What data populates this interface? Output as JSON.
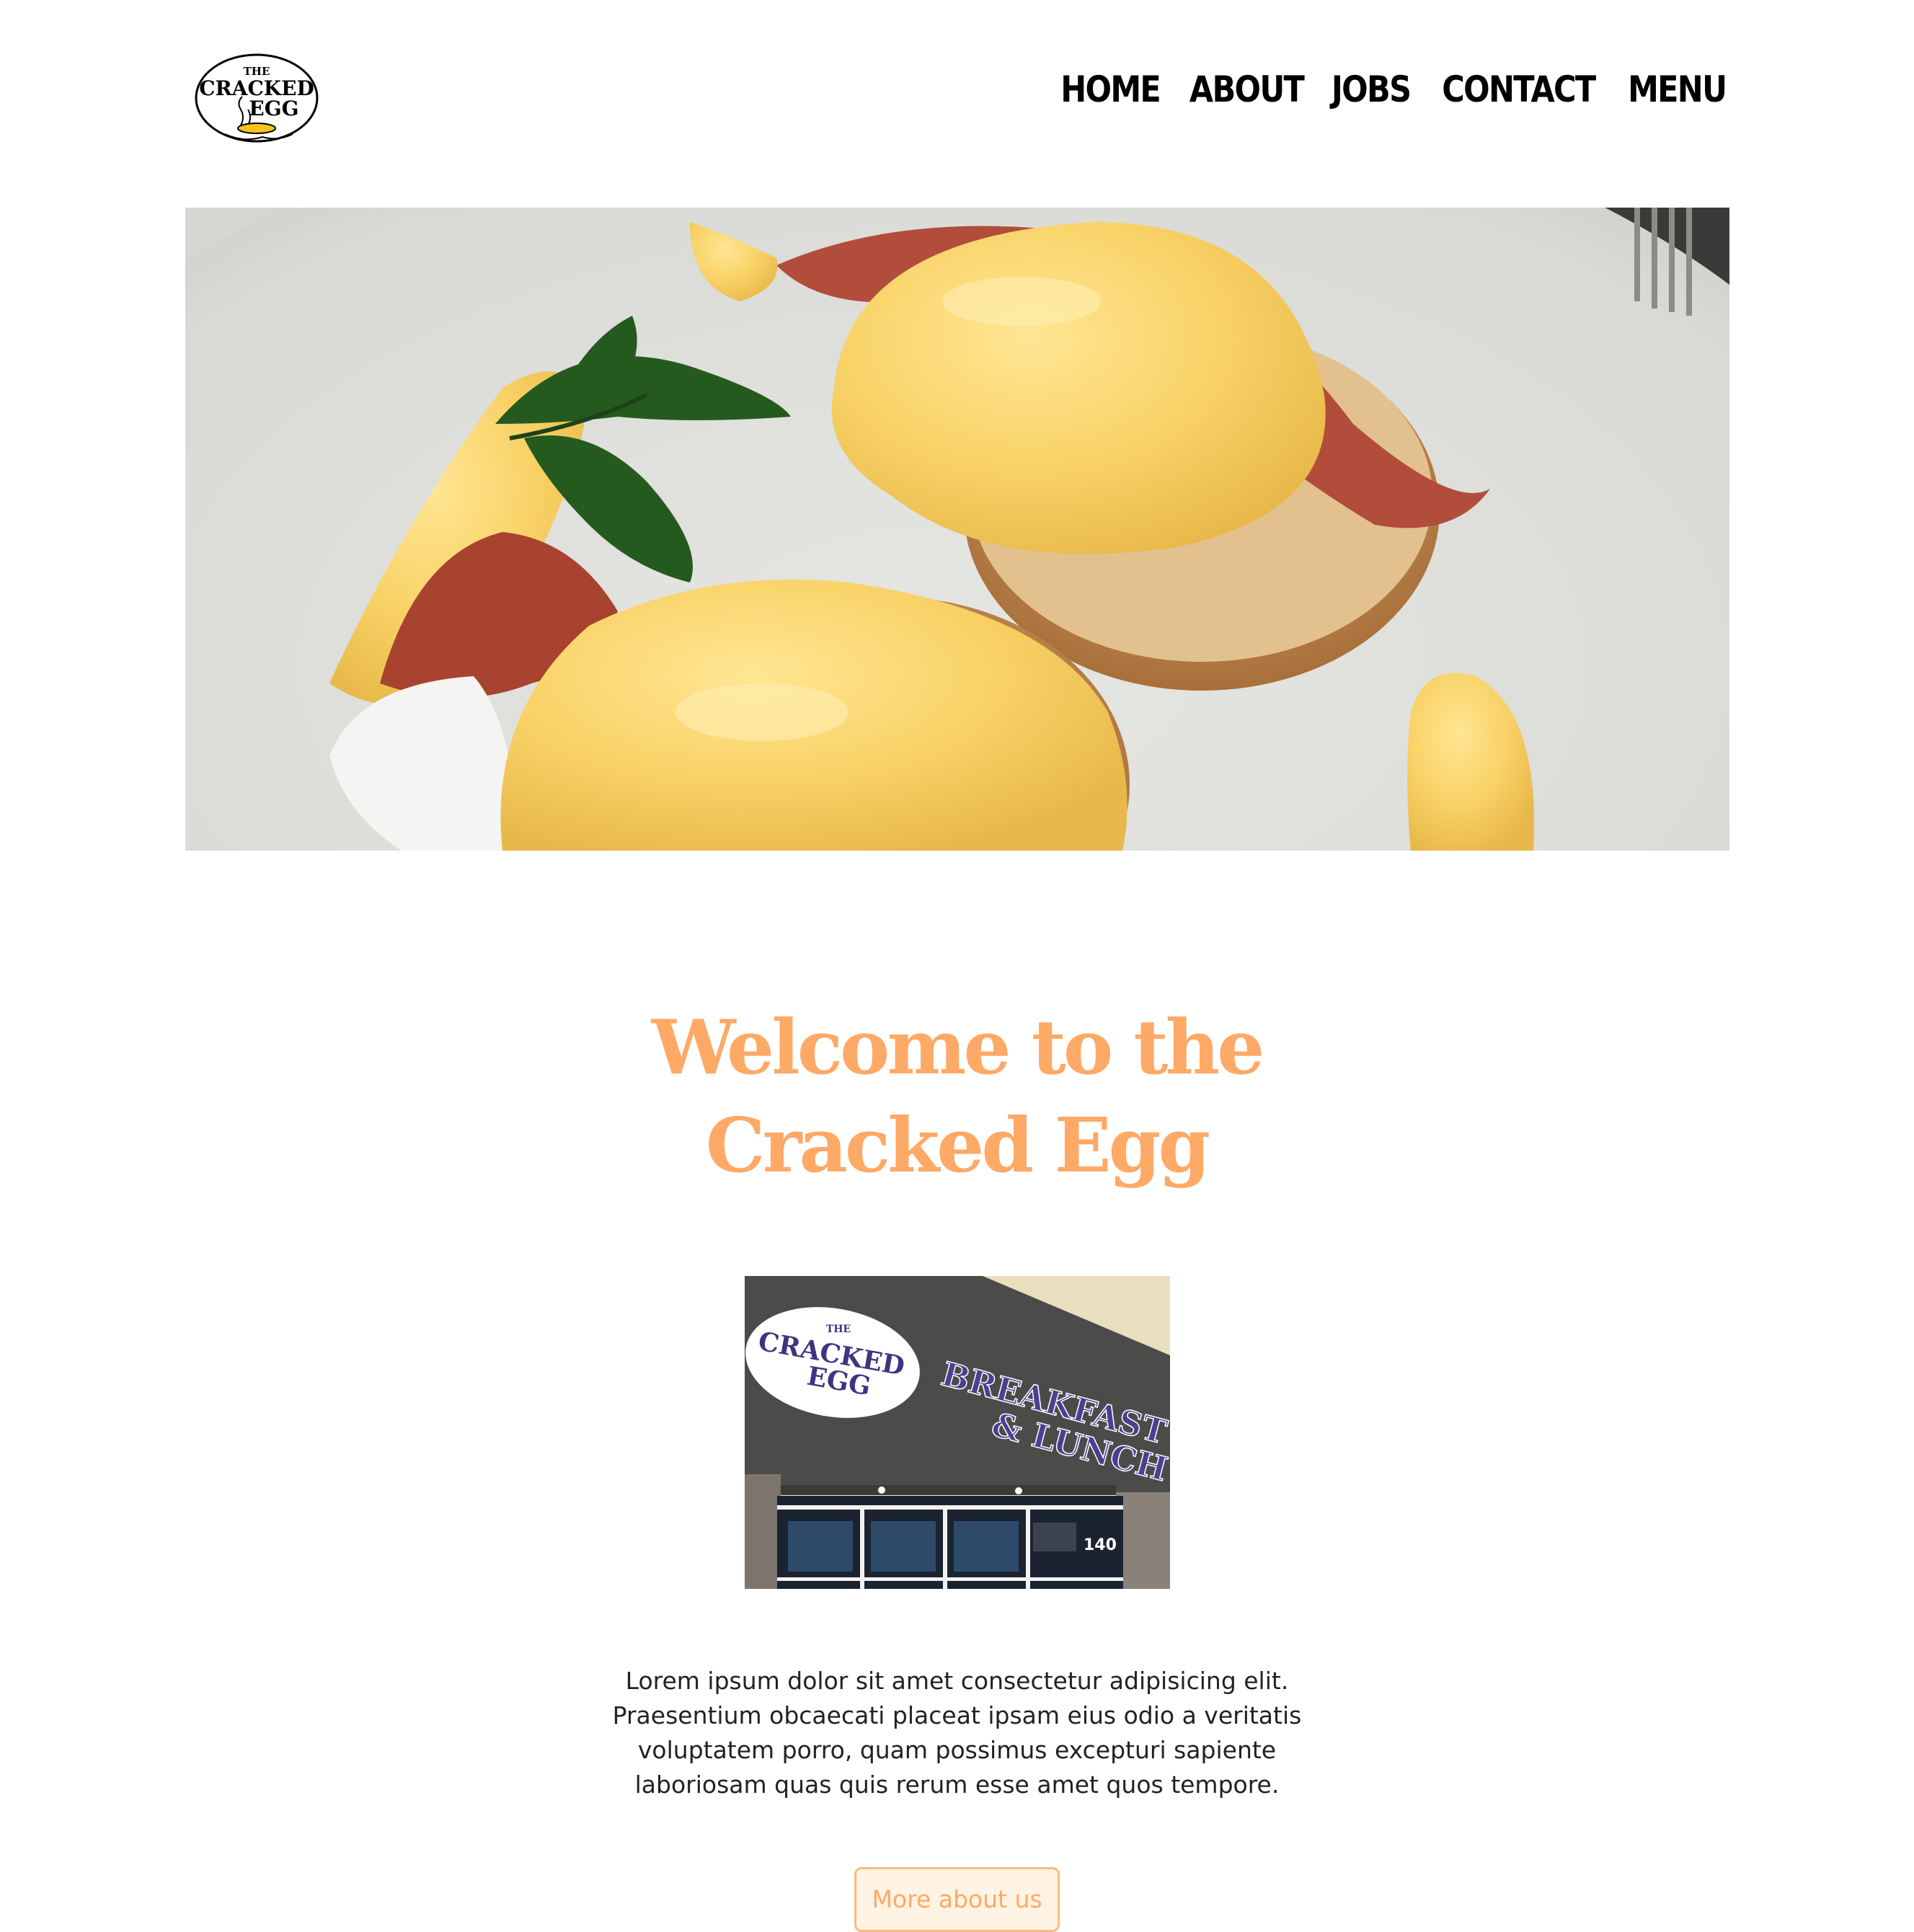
{
  "header": {
    "logo": {
      "line1": "THE",
      "line2": "CRACKED",
      "line3": "EGG"
    },
    "nav": [
      {
        "label": "HOME"
      },
      {
        "label": "ABOUT"
      },
      {
        "label": "JOBS"
      },
      {
        "label": "CONTACT"
      },
      {
        "label": "MENU"
      }
    ]
  },
  "welcome": {
    "line1": "Welcome to the",
    "line2": "Cracked Egg"
  },
  "storefront": {
    "sign_line1": "THE",
    "sign_line2": "CRACKED",
    "sign_line3": "EGG",
    "banner_line1": "BREAKFAST",
    "banner_line2": "& LUNCH",
    "unit_number": "140"
  },
  "intro": {
    "text": "Lorem ipsum dolor sit amet consectetur adipisicing elit. Praesentium obcaecati placeat ipsam eius odio a veritatis voluptatem porro, quam possimus excepturi sapiente laboriosam quas quis rerum esse amet quos tempore."
  },
  "more_button": {
    "label": "More about us"
  },
  "colors": {
    "accent": "#ffa967",
    "button_bg": "#fff3e3",
    "nav_text": "#000000",
    "body_text": "#222222"
  }
}
